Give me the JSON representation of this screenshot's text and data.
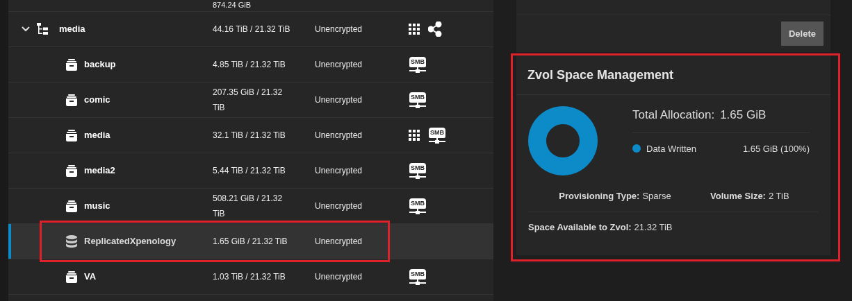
{
  "tree": {
    "partial_row": {
      "used": "874.24 GiB"
    },
    "rows": [
      {
        "kind": "parent",
        "name": "media",
        "expanded": true,
        "used": "44.16 TiB / 21.32 TiB",
        "encryption": "Unencrypted",
        "selected": false,
        "actions": [
          {
            "kind": "grid"
          },
          {
            "kind": "share"
          }
        ]
      },
      {
        "kind": "child",
        "name": "backup",
        "used": "4.85 TiB / 21.32 TiB",
        "encryption": "Unencrypted",
        "selected": false,
        "actions": [
          {
            "kind": "smb",
            "label": "SMB"
          }
        ]
      },
      {
        "kind": "child",
        "name": "comic",
        "used": "207.35 GiB / 21.32 TiB",
        "encryption": "Unencrypted",
        "selected": false,
        "actions": [
          {
            "kind": "smb",
            "label": "SMB"
          }
        ]
      },
      {
        "kind": "child",
        "name": "media",
        "used": "32.1 TiB / 21.32 TiB",
        "encryption": "Unencrypted",
        "selected": false,
        "actions": [
          {
            "kind": "grid"
          },
          {
            "kind": "smb",
            "label": "SMB"
          }
        ]
      },
      {
        "kind": "child",
        "name": "media2",
        "used": "5.44 TiB / 21.32 TiB",
        "encryption": "Unencrypted",
        "selected": false,
        "actions": [
          {
            "kind": "smb",
            "label": "SMB"
          }
        ]
      },
      {
        "kind": "child",
        "name": "music",
        "used": "508.21 GiB / 21.32 TiB",
        "encryption": "Unencrypted",
        "selected": false,
        "actions": [
          {
            "kind": "smb",
            "label": "SMB"
          }
        ]
      },
      {
        "kind": "zvol",
        "name": "ReplicatedXpenology",
        "used": "1.65 GiB / 21.32 TiB",
        "encryption": "Unencrypted",
        "selected": true,
        "actions": []
      },
      {
        "kind": "child",
        "name": "VA",
        "used": "1.03 TiB / 21.32 TiB",
        "encryption": "Unencrypted",
        "selected": false,
        "actions": [
          {
            "kind": "smb",
            "label": "SMB"
          }
        ]
      }
    ]
  },
  "top_card": {
    "button": "Delete"
  },
  "zvol_card": {
    "title": "Zvol Space Management",
    "total_label": "Total Allocation:",
    "total_value": "1.65 GiB",
    "legend": [
      {
        "label": "Data Written",
        "value": "1.65 GiB (100%)",
        "color": "#0d8ac8"
      }
    ],
    "provisioning_label": "Provisioning Type:",
    "provisioning_value": "Sparse",
    "size_label": "Volume Size:",
    "size_value": "2 TiB",
    "available_label": "Space Available to Zvol:",
    "available_value": "21.32 TiB"
  }
}
